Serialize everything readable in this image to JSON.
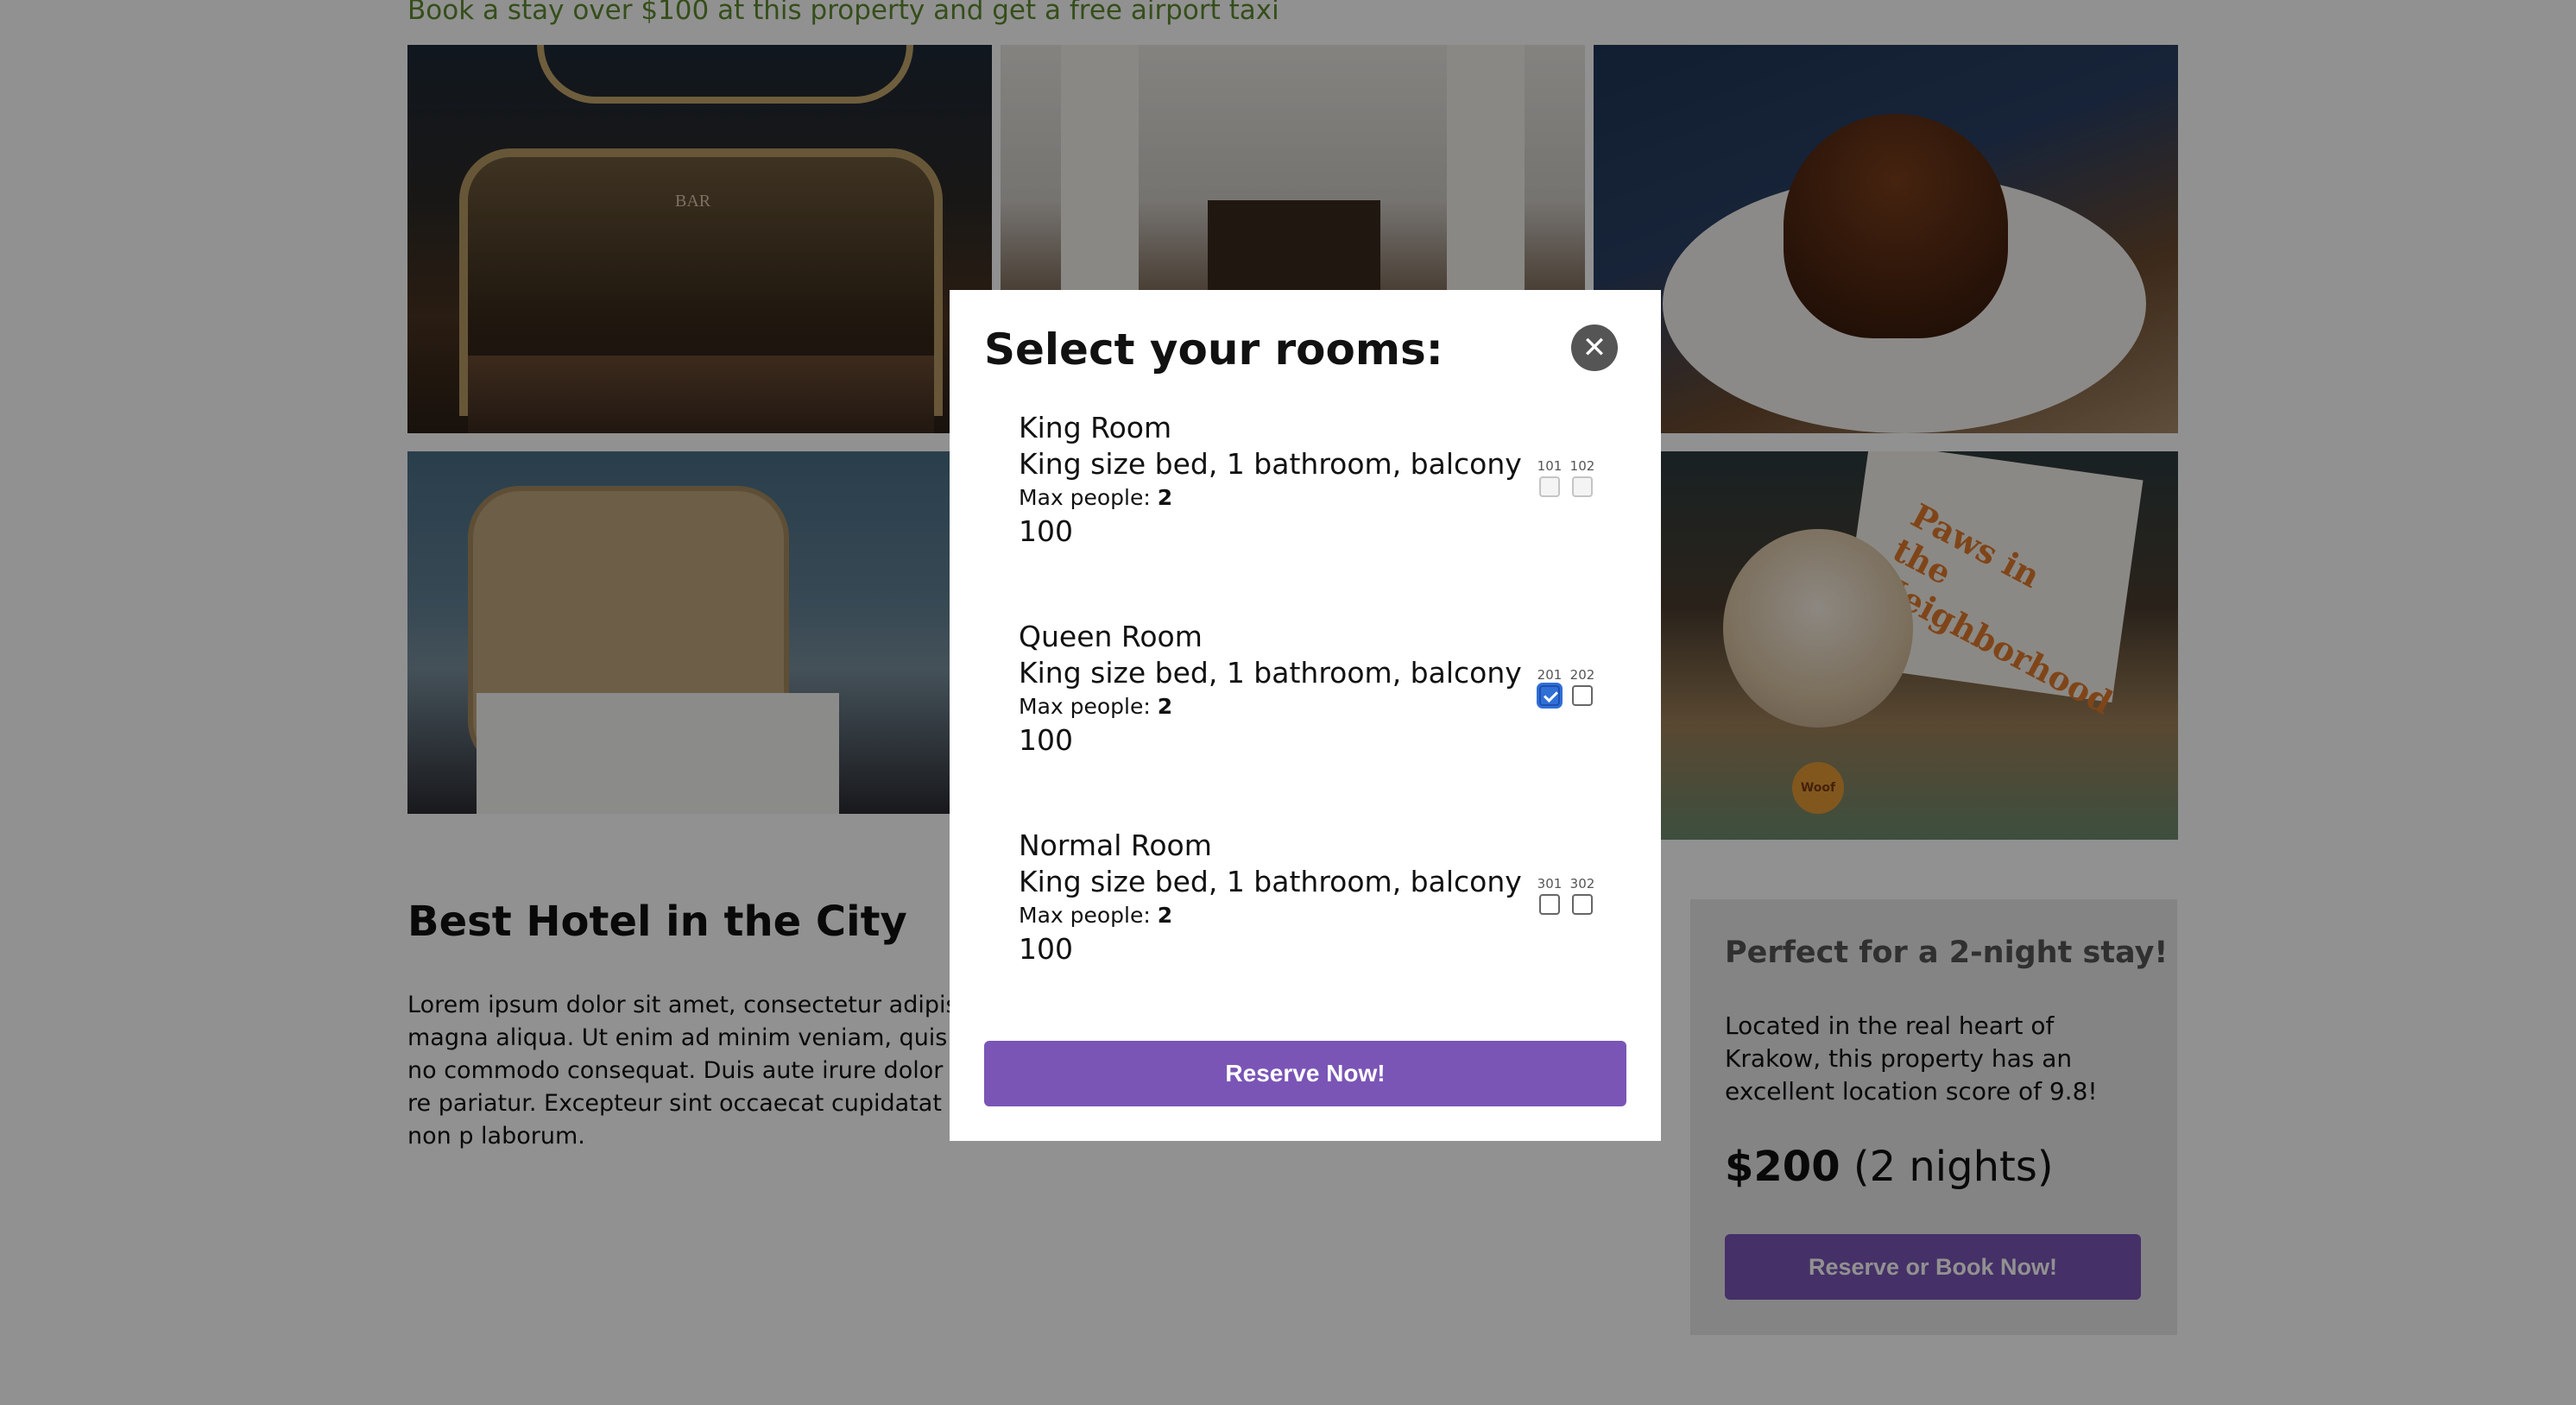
{
  "promo": "Book a stay over $100 at this property and get a free airport taxi",
  "hotel": {
    "title": "Best Hotel in the City",
    "description": "Lorem ipsum dolor sit amet, consectetur adipisc magna aliqua. Ut enim ad minim veniam, quis no commodo consequat. Duis aute irure dolor in re pariatur. Excepteur sint occaecat cupidatat non p laborum."
  },
  "side_panel": {
    "title": "Perfect for a 2-night stay!",
    "text": "Located in the real heart of Krakow, this property has an excellent location score of 9.8!",
    "price": "$200",
    "price_note": "(2 nights)",
    "button_label": "Reserve or Book Now!"
  },
  "photo_labels": {
    "bar_sign": "BAR",
    "bag_text": "Paws in the Neighborhood",
    "ball_text": "Woof"
  },
  "modal": {
    "title": "Select your rooms:",
    "close_icon": "✕",
    "reserve_label": "Reserve Now!",
    "max_people_label": "Max people:",
    "rooms": [
      {
        "name": "King Room",
        "desc": "King size bed, 1 bathroom, balcony",
        "max_people": "2",
        "price": "100",
        "numbers": [
          {
            "label": "101",
            "state": "disabled"
          },
          {
            "label": "102",
            "state": "disabled"
          }
        ]
      },
      {
        "name": "Queen Room",
        "desc": "King size bed, 1 bathroom, balcony",
        "max_people": "2",
        "price": "100",
        "numbers": [
          {
            "label": "201",
            "state": "checked"
          },
          {
            "label": "202",
            "state": "unchecked"
          }
        ]
      },
      {
        "name": "Normal Room",
        "desc": "King size bed, 1 bathroom, balcony",
        "max_people": "2",
        "price": "100",
        "numbers": [
          {
            "label": "301",
            "state": "unchecked"
          },
          {
            "label": "302",
            "state": "unchecked"
          }
        ]
      }
    ]
  },
  "colors": {
    "accent": "#7a55b6",
    "promo": "#5d8a2f",
    "checkbox_checked": "#2f6fd6"
  }
}
